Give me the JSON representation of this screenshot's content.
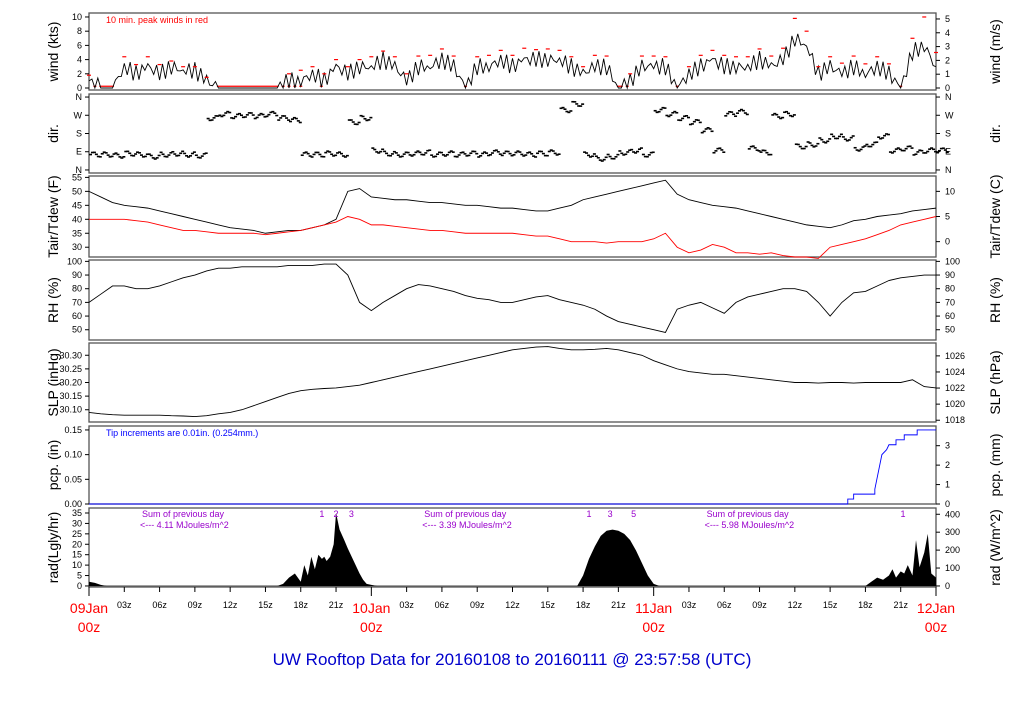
{
  "title": "UW Rooftop Data for 20160108  to  20160111 @ 23:57:58  (UTC)",
  "colors": {
    "obs": "#000000",
    "peak": "#ff0000",
    "dew": "#ff0000",
    "pcp": "#0000ff",
    "note": "#9900cc",
    "day": "#ff0000",
    "title": "#0000cc"
  },
  "time_axis": {
    "range_hours": [
      0,
      72
    ],
    "hour_labels": [
      "03z",
      "06z",
      "09z",
      "12z",
      "15z",
      "18z",
      "21z"
    ],
    "days": [
      {
        "hour": 0,
        "date": "09Jan",
        "time": "00z"
      },
      {
        "hour": 24,
        "date": "10Jan",
        "time": "00z"
      },
      {
        "hour": 48,
        "date": "11Jan",
        "time": "00z"
      },
      {
        "hour": 72,
        "date": "12Jan",
        "time": "00z"
      }
    ]
  },
  "chart_data": [
    {
      "type": "line",
      "id": "wind",
      "ylabel": "wind (kts)",
      "ylabel_right": "wind (m/s)",
      "ylim": [
        -0.28,
        10.56
      ],
      "yticks": [
        0,
        2,
        4,
        6,
        8,
        10
      ],
      "yticks_right": [
        0,
        1,
        2,
        3,
        4,
        5
      ],
      "right_factor": 0.5144,
      "annotation": "10 min. peak winds in red",
      "series": [
        {
          "name": "wind",
          "values": [
            1,
            0,
            0,
            3,
            2,
            3,
            2,
            3,
            2.5,
            2.5,
            1,
            0,
            0,
            0,
            0,
            0,
            0,
            1,
            1,
            2,
            1,
            3,
            2,
            3,
            3,
            4,
            3,
            1,
            3,
            3,
            4,
            3,
            0,
            3,
            3,
            4,
            3,
            4,
            4,
            4,
            4,
            3,
            2,
            3,
            3,
            0,
            1,
            3,
            3,
            3,
            0,
            2,
            3,
            4,
            3,
            3,
            3,
            4,
            3,
            4,
            7,
            6,
            2,
            3,
            2,
            3,
            2,
            3,
            2,
            0,
            5,
            6,
            3
          ]
        },
        {
          "name": "peak",
          "values": [
            1.8,
            0,
            0,
            4.4,
            3.3,
            4.4,
            3.3,
            3.8,
            3,
            3,
            1.5,
            0,
            0,
            0,
            0,
            0,
            0,
            2,
            2.5,
            3,
            2,
            4,
            3,
            4,
            4.4,
            5.2,
            4.4,
            2,
            4.5,
            4.6,
            5.5,
            4.5,
            0,
            4.4,
            4.6,
            5.3,
            4.6,
            5.6,
            5.4,
            5.5,
            5.3,
            4.4,
            3,
            4.6,
            4.5,
            0,
            2,
            4.5,
            4.5,
            4.4,
            0,
            3,
            4.6,
            5.3,
            4.6,
            4.4,
            4.4,
            5.5,
            4.5,
            5.6,
            9.8,
            8,
            3,
            4.4,
            3.5,
            4.5,
            3.4,
            4.4,
            3.4,
            0,
            7,
            10,
            5
          ]
        }
      ]
    },
    {
      "type": "scatter",
      "id": "dir",
      "ylabel": "dir.",
      "ylabel_right": "dir.",
      "ylim": [
        -15,
        375
      ],
      "yticks": [
        0,
        90,
        180,
        270,
        360
      ],
      "ytick_labels": [
        "N",
        "E",
        "S",
        "W",
        "N"
      ],
      "series": [
        {
          "name": "direction",
          "values": [
            80,
            80,
            75,
            85,
            80,
            70,
            80,
            85,
            80,
            75,
            260,
            280,
            270,
            275,
            270,
            280,
            260,
            250,
            80,
            80,
            85,
            80,
            240,
            260,
            100,
            85,
            80,
            85,
            90,
            80,
            85,
            80,
            85,
            80,
            90,
            85,
            85,
            80,
            85,
            90,
            300,
            330,
            80,
            60,
            70,
            90,
            100,
            80,
            300,
            280,
            260,
            240,
            200,
            100,
            280,
            290,
            110,
            90,
            270,
            280,
            120,
            130,
            150,
            170,
            160,
            110,
            130,
            170,
            100,
            110,
            90,
            100,
            100
          ]
        }
      ]
    },
    {
      "type": "line",
      "id": "tair",
      "ylabel": "Tair/Tdew (F)",
      "ylabel_right": "Tair/Tdew (C)",
      "ylim": [
        26.5,
        55.5
      ],
      "yticks": [
        30,
        35,
        40,
        45,
        50,
        55
      ],
      "yticks_right": [
        0,
        5,
        10
      ],
      "series": [
        {
          "name": "Tair",
          "values": [
            50,
            48,
            46,
            45,
            44.5,
            44,
            43,
            42,
            41,
            40,
            39,
            38,
            37,
            36.5,
            36,
            35,
            35.5,
            36,
            36,
            37,
            38,
            40,
            50,
            51,
            48,
            47.5,
            47,
            47,
            46.5,
            46,
            46,
            45.5,
            45,
            45,
            44.5,
            44,
            44,
            43.5,
            43,
            43,
            44,
            45,
            47,
            48,
            49,
            50,
            51,
            52,
            53,
            54,
            49,
            47,
            46,
            45,
            44.5,
            44,
            43,
            42,
            41,
            40,
            39,
            38,
            37.5,
            37,
            38,
            39.5,
            40,
            41,
            41.5,
            42,
            43,
            43.5,
            44
          ]
        },
        {
          "name": "Tdew",
          "values": [
            40,
            40,
            40,
            40,
            39.5,
            39,
            38,
            37,
            36,
            36,
            35.5,
            35,
            35,
            35,
            35,
            34.5,
            35,
            35.5,
            36,
            37,
            38,
            39,
            41,
            40,
            38,
            38,
            37.5,
            37,
            36.5,
            36,
            36,
            35.5,
            35,
            35,
            35,
            35,
            35,
            34.5,
            34,
            34,
            33,
            32,
            32,
            32,
            31.5,
            32,
            32,
            32,
            33,
            35,
            30,
            28,
            29,
            31,
            30,
            28,
            28,
            27.5,
            28,
            27,
            26.5,
            26.5,
            26,
            30,
            31,
            32,
            33,
            34.5,
            36,
            38,
            39,
            40,
            41
          ]
        }
      ]
    },
    {
      "type": "line",
      "id": "rh",
      "ylabel": "RH (%)",
      "ylabel_right": "RH (%)",
      "ylim": [
        42.5,
        101
      ],
      "yticks": [
        50,
        60,
        70,
        80,
        90,
        100
      ],
      "yticks_right": [
        50,
        60,
        70,
        80,
        90,
        100
      ],
      "series": [
        {
          "name": "RH",
          "values": [
            70,
            76,
            82,
            82,
            80,
            80,
            82,
            85,
            88,
            90,
            93,
            95,
            95,
            96,
            96,
            96,
            96,
            97,
            97,
            97,
            98,
            98,
            90,
            70,
            64,
            70,
            75,
            80,
            83,
            82,
            80,
            78,
            75,
            73,
            72,
            70,
            70,
            72,
            74,
            75,
            72,
            70,
            68,
            65,
            60,
            56,
            54,
            52,
            50,
            48,
            65,
            68,
            70,
            66,
            62,
            70,
            74,
            76,
            78,
            80,
            80,
            78,
            70,
            60,
            70,
            77,
            78,
            82,
            86,
            88,
            89,
            90,
            90
          ]
        }
      ]
    },
    {
      "type": "line",
      "id": "slp",
      "ylabel": "SLP (inHg)",
      "ylabel_right": "SLP (hPa)",
      "ylim": [
        30.055,
        30.345
      ],
      "yticks": [
        30.1,
        30.15,
        30.2,
        30.25,
        30.3
      ],
      "ytick_labels": [
        "30.10",
        "30.15",
        "30.20",
        "30.25",
        "30.30"
      ],
      "yticks_right": [
        1018,
        1020,
        1022,
        1024,
        1026
      ],
      "right_factor": 33.8639,
      "series": [
        {
          "name": "SLP",
          "values": [
            30.09,
            30.085,
            30.082,
            30.08,
            30.08,
            30.08,
            30.08,
            30.078,
            30.077,
            30.075,
            30.078,
            30.085,
            30.09,
            30.1,
            30.115,
            30.13,
            30.145,
            30.16,
            30.17,
            30.175,
            30.178,
            30.18,
            30.185,
            30.19,
            30.2,
            30.21,
            30.22,
            30.23,
            30.24,
            30.25,
            30.26,
            30.27,
            30.28,
            30.29,
            30.3,
            30.31,
            30.32,
            30.325,
            30.33,
            30.332,
            30.325,
            30.32,
            30.32,
            30.322,
            30.325,
            30.32,
            30.31,
            30.3,
            30.28,
            30.265,
            30.25,
            30.24,
            30.235,
            30.23,
            30.23,
            30.225,
            30.22,
            30.215,
            30.21,
            30.205,
            30.2,
            30.2,
            30.198,
            30.2,
            30.2,
            30.198,
            30.2,
            30.2,
            30.2,
            30.2,
            30.21,
            30.185,
            30.18
          ]
        }
      ]
    },
    {
      "type": "line",
      "id": "pcp",
      "ylabel": "pcp. (in)",
      "ylabel_right": "pcp. (mm)",
      "ylim": [
        0,
        0.158
      ],
      "yticks": [
        0,
        0.05,
        0.1,
        0.15
      ],
      "ytick_labels": [
        "0.00",
        "0.05",
        "0.10",
        "0.15"
      ],
      "yticks_right": [
        0,
        1,
        2,
        3
      ],
      "right_factor": 25.4,
      "annotation": "Tip increments are 0.01in. (0.254mm.)",
      "series": [
        {
          "name": "pcp",
          "x": [
            0,
            64.5,
            64.5,
            65,
            65,
            66.8,
            66.8,
            67.4,
            67.8,
            68,
            68.6,
            68.6,
            69.3,
            69.3,
            70.4,
            70.4,
            72
          ],
          "values": [
            0,
            0,
            0.01,
            0.01,
            0.02,
            0.02,
            0.03,
            0.1,
            0.11,
            0.12,
            0.12,
            0.13,
            0.13,
            0.14,
            0.14,
            0.15,
            0.15
          ]
        }
      ]
    },
    {
      "type": "area",
      "id": "rad",
      "ylabel": "rad(Lgly/hr)",
      "ylabel_right": "rad (W/m^2)",
      "ylim": [
        -0.5,
        37.4
      ],
      "yticks": [
        0,
        5,
        10,
        15,
        20,
        25,
        30,
        35
      ],
      "yticks_right": [
        0,
        100,
        200,
        300,
        400
      ],
      "right_factor": 11.63,
      "series": [
        {
          "name": "radiation",
          "x": [
            0,
            0.5,
            1,
            1.5,
            16,
            16.5,
            17,
            17.5,
            18,
            18.3,
            18.6,
            18.9,
            19.2,
            19.5,
            19.8,
            20,
            20.2,
            20.5,
            20.8,
            21,
            21.3,
            21.7,
            22,
            22.5,
            23,
            23.3,
            23.6,
            24,
            24.5,
            41.5,
            42,
            42.5,
            43,
            43.5,
            44,
            44.5,
            45,
            45.5,
            46,
            46.5,
            47,
            47.5,
            48,
            48.5,
            66,
            66.5,
            67,
            67.5,
            68,
            68.3,
            68.6,
            69,
            69.3,
            69.6,
            70,
            70.3,
            70.6,
            71,
            71.3,
            71.6,
            72
          ],
          "values": [
            2,
            1.5,
            0.5,
            0,
            0,
            1,
            4,
            6,
            2,
            10,
            5,
            14,
            8,
            15,
            13,
            14,
            12,
            14,
            20,
            35,
            27,
            22,
            18,
            12,
            6,
            3,
            1,
            0.5,
            0,
            0,
            5,
            13,
            19,
            24,
            26.5,
            27,
            26.5,
            25,
            22,
            17,
            11,
            5,
            1,
            0,
            0,
            2,
            4,
            3,
            5,
            8,
            4,
            7,
            6,
            10,
            5,
            22,
            9,
            16,
            25,
            6,
            4
          ]
        }
      ],
      "day_notes": [
        {
          "hour": 4.5,
          "line1": "Sum of previous day",
          "line2": "<--- 4.11 MJoules/m^2",
          "marks": [
            {
              "hour": 19.8,
              "label": "1"
            },
            {
              "hour": 21,
              "label": "2"
            },
            {
              "hour": 22.3,
              "label": "3"
            }
          ]
        },
        {
          "hour": 28.5,
          "line1": "Sum of previous day",
          "line2": "<--- 3.39 MJoules/m^2",
          "marks": [
            {
              "hour": 42.5,
              "label": "1"
            },
            {
              "hour": 44.3,
              "label": "3"
            },
            {
              "hour": 46.3,
              "label": "5"
            }
          ]
        },
        {
          "hour": 52.5,
          "line1": "Sum of previous day",
          "line2": "<--- 5.98 MJoules/m^2",
          "marks": [
            {
              "hour": 69.2,
              "label": "1"
            }
          ]
        }
      ]
    }
  ]
}
